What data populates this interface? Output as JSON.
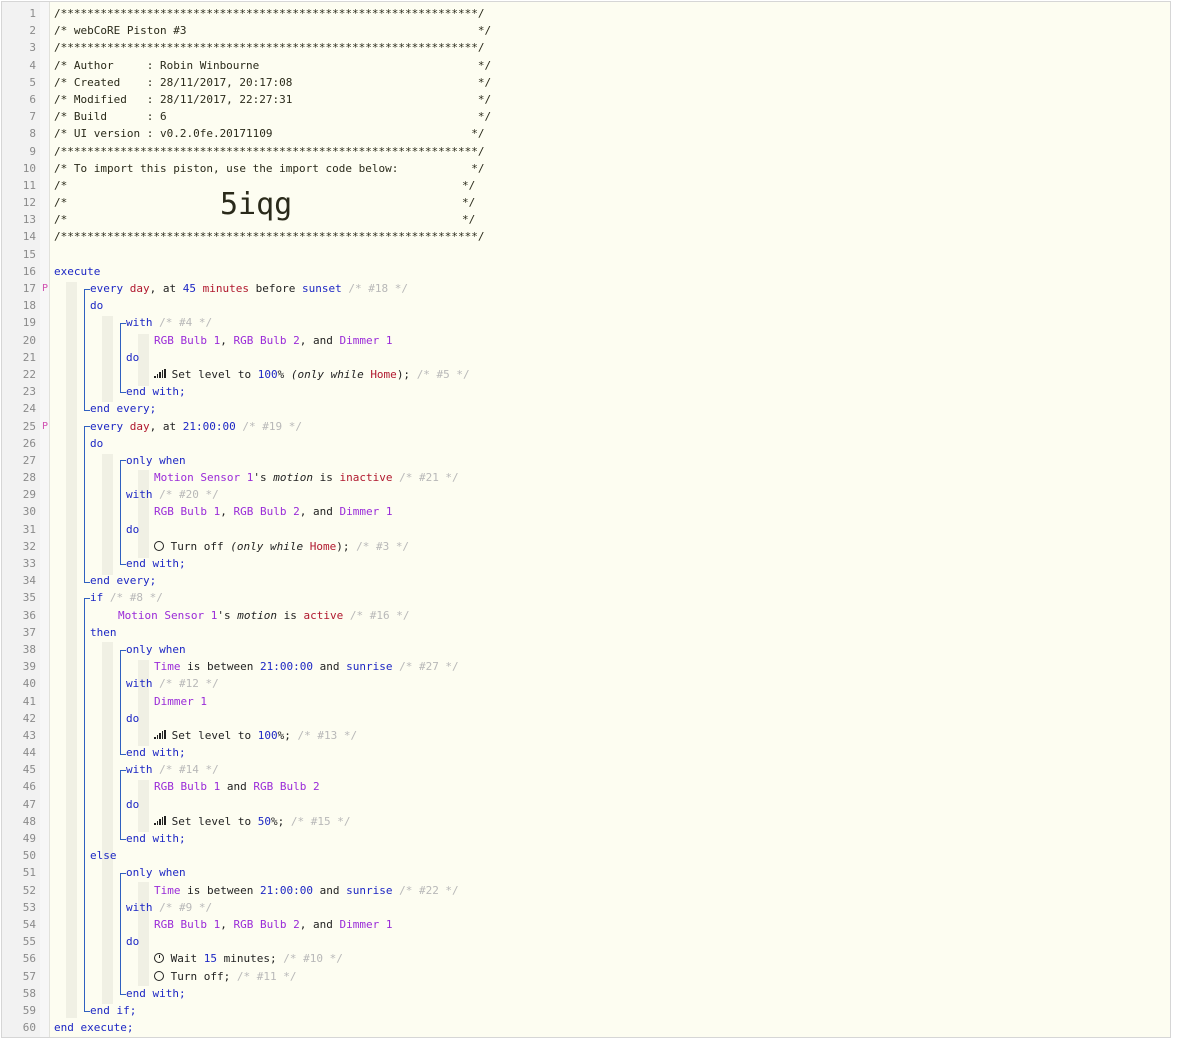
{
  "header": {
    "border": "/***************************************************************/",
    "title": "/* webCoRE Piston #3                                            */",
    "author": "/* Author     : Robin Winbourne                                 */",
    "created": "/* Created    : 28/11/2017, 20:17:08                            */",
    "modified": "/* Modified   : 28/11/2017, 22:27:31                            */",
    "build": "/* Build      : 6                                               */",
    "ui_version": "/* UI version : v0.2.0fe.20171109                              */",
    "import_text": "/* To import this piston, use the import code below:           */",
    "empty_left": "/*",
    "empty_right": "*/",
    "import_code": "5iqg"
  },
  "line_numbers": [
    "1",
    "2",
    "3",
    "4",
    "5",
    "6",
    "7",
    "8",
    "9",
    "10",
    "11",
    "12",
    "13",
    "14",
    "15",
    "16",
    "17",
    "18",
    "19",
    "20",
    "21",
    "22",
    "23",
    "24",
    "25",
    "26",
    "27",
    "28",
    "29",
    "30",
    "31",
    "32",
    "33",
    "34",
    "35",
    "36",
    "37",
    "38",
    "39",
    "40",
    "41",
    "42",
    "43",
    "44",
    "45",
    "46",
    "47",
    "48",
    "49",
    "50",
    "51",
    "52",
    "53",
    "54",
    "55",
    "56",
    "57",
    "58",
    "59",
    "60"
  ],
  "fold_marker": "P",
  "code": {
    "execute": "execute",
    "end_execute": "end execute;",
    "every": "every",
    "day": "day",
    "comma_at": ", at ",
    "n45": "45",
    "minutes": "minutes",
    "before": " before ",
    "sunset": "sunset",
    "c18": "/* #18 */",
    "do": "do",
    "with": "with",
    "c4": "/* #4 */",
    "bulb1": "RGB Bulb 1",
    "bulb2": "RGB Bulb 2",
    "dimmer1": "Dimmer 1",
    "sep": ", ",
    "and": " and ",
    "comma_and": ", and ",
    "set_level_to": " Set level to ",
    "p100": "100",
    "p50": "50",
    "pct": "%",
    "pct_semi": "%;",
    "only_while_open": " (only while ",
    "home": "Home",
    "close_semi": ");",
    "c5": "/* #5 */",
    "end_with": "end with;",
    "end_every": "end every;",
    "t2100": "21:00:00",
    "c19": "/* #19 */",
    "only_when": "only when",
    "motion_sensor": "Motion Sensor 1",
    "s_apos": "'s ",
    "motion": "motion",
    "is": " is ",
    "inactive": "inactive",
    "active": "active",
    "c21": "/* #21 */",
    "c20": "/* #20 */",
    "turn_off": " Turn off",
    "turn_off_semi": " Turn off;",
    "c3": "/* #3 */",
    "if": "if",
    "c8": "/* #8 */",
    "c16": "/* #16 */",
    "then": "then",
    "time": "Time",
    "is_between": " is between ",
    "sunrise": "sunrise",
    "c27": "/* #27 */",
    "c12": "/* #12 */",
    "c13": "/* #13 */",
    "c14": "/* #14 */",
    "c15": "/* #15 */",
    "else": "else",
    "c22": "/* #22 */",
    "c9": "/* #9 */",
    "wait": " Wait ",
    "n15": "15",
    "minutes_semi": " minutes;",
    "c10": "/* #10 */",
    "c11": "/* #11 */",
    "end_if": "end if;"
  },
  "colors": {
    "keyword": "#1d27c4",
    "device": "#9a2bd8",
    "value_red": "#b0182e",
    "comment_gray": "#b8b8b8",
    "background": "#fdfdf1"
  }
}
